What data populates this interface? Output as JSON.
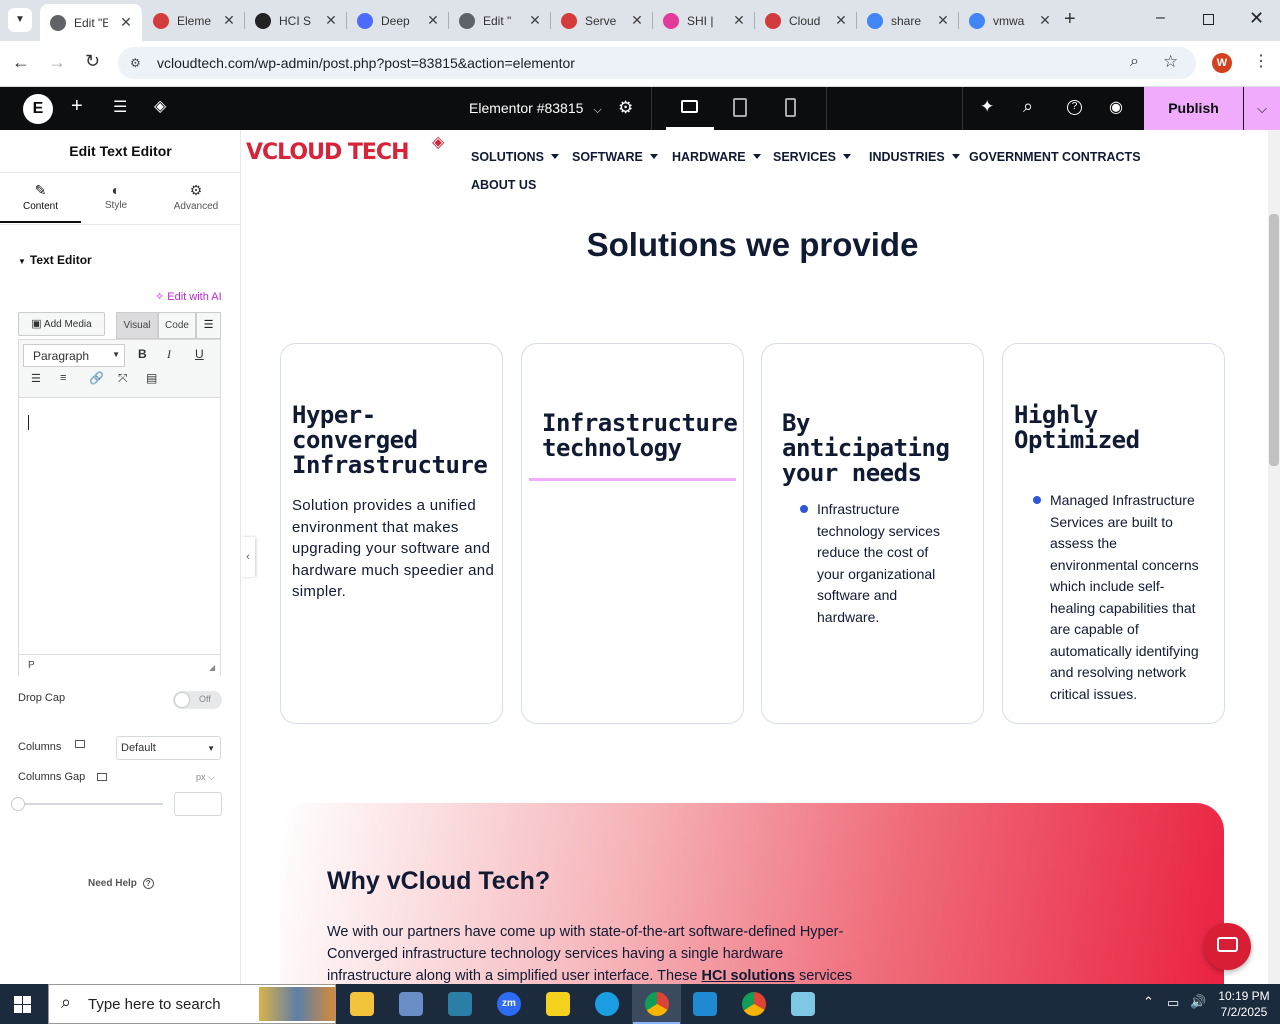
{
  "browser": {
    "tabs": [
      {
        "label": "Edit \"E",
        "active": true,
        "icon": "globe-icon",
        "color": "#5f6368"
      },
      {
        "label": "Eleme",
        "icon": "elementor-diamond-icon",
        "color": "#d63b3b"
      },
      {
        "label": "HCI S",
        "icon": "chatgpt-icon",
        "color": "#222222"
      },
      {
        "label": "Deep",
        "icon": "deepseek-icon",
        "color": "#4d6bfe"
      },
      {
        "label": "Edit \"",
        "icon": "globe-icon",
        "color": "#5f6368"
      },
      {
        "label": "Serve",
        "icon": "elementor-diamond-icon",
        "color": "#d63b3b"
      },
      {
        "label": "SHI | ",
        "icon": "shi-icon",
        "color": "#e23b9a"
      },
      {
        "label": "Cloud",
        "icon": "cloud-logo-icon",
        "color": "#d23b3b"
      },
      {
        "label": "share",
        "icon": "google-icon",
        "color": "#4285f4"
      },
      {
        "label": "vmwa",
        "icon": "google-icon",
        "color": "#4285f4"
      }
    ],
    "url": "vcloudtech.com/wp-admin/post.php?post=83815&action=elementor",
    "profile_initial": "W"
  },
  "elementor": {
    "doc_title": "Elementor #83815",
    "publish_label": "Publish"
  },
  "panel": {
    "title": "Edit Text Editor",
    "tabs": [
      "Content",
      "Style",
      "Advanced"
    ],
    "section_title": "Text Editor",
    "edit_ai": "Edit with AI",
    "add_media": "Add Media",
    "visual": "Visual",
    "code": "Code",
    "format_select": "Paragraph",
    "path": "P",
    "drop_cap_label": "Drop Cap",
    "drop_cap_value": "Off",
    "columns_label": "Columns",
    "columns_value": "Default",
    "columns_gap_label": "Columns Gap",
    "columns_gap_unit": "px",
    "need_help": "Need Help"
  },
  "site": {
    "logo_text": "VCLOUD TECH",
    "menu": [
      "SOLUTIONS",
      "SOFTWARE",
      "HARDWARE",
      "SERVICES",
      "INDUSTRIES",
      "GOVERNMENT CONTRACTS",
      "ABOUT US"
    ],
    "heading": "Solutions we provide",
    "cards": [
      {
        "title_lines": [
          "Hyper-",
          "converged",
          "Infrastructure"
        ],
        "text_lines": [
          "Solution provides a unified",
          "environment that makes",
          "upgrading your software and",
          "hardware much speedier and",
          "simpler."
        ]
      },
      {
        "title_lines": [
          "Infrastructure",
          "technology"
        ]
      },
      {
        "title_lines": [
          "By anticipating",
          "your needs"
        ],
        "bullet_lines": [
          "Infrastructure",
          "technology services",
          "reduce the cost of",
          "your organizational",
          "software and",
          "hardware."
        ]
      },
      {
        "title_lines": [
          "Highly",
          "Optimized"
        ],
        "bullet_lines": [
          "Managed Infrastructure",
          "Services are built to",
          "assess the",
          "environmental concerns",
          "which include self-",
          "healing capabilities that",
          "are capable of",
          "automatically identifying",
          "and resolving network",
          "critical issues."
        ]
      }
    ],
    "why_title": "Why vCloud Tech?",
    "why_lines": [
      "We with our partners have come up with state-of-the-art software-defined Hyper-",
      "Converged infrastructure technology services having a single hardware"
    ],
    "why_line3_pre": "infrastructure along with a simplified user interface. These ",
    "why_line3_link": "HCI solutions",
    "why_line3_post": " services"
  },
  "taskbar": {
    "search_placeholder": "Type here to search",
    "time": "10:19 PM",
    "date": "7/2/2025"
  }
}
